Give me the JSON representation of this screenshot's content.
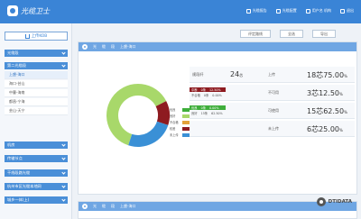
{
  "app": {
    "title": "光缆卫士"
  },
  "header": {
    "items": [
      {
        "label": "光缆报告",
        "icon": "report-icon"
      },
      {
        "label": "光缆配置",
        "icon": "settings-icon"
      },
      {
        "label": "用户名 机构",
        "icon": "user-icon"
      },
      {
        "label": "退出",
        "icon": "logout-icon"
      }
    ]
  },
  "sidebar": {
    "upload_label": "上传KOB",
    "groups": [
      {
        "label": "光缆段"
      },
      {
        "label": "第二光缆段"
      },
      {
        "label": "机房"
      },
      {
        "label": "传输节点"
      },
      {
        "label": "干线段路光缆"
      },
      {
        "label": "杭州市区光缆本地网"
      },
      {
        "label": "城乡一体(上)"
      }
    ],
    "items": [
      {
        "label": "上虞-海口"
      },
      {
        "label": "海口-芸山"
      },
      {
        "label": "中曹-海南"
      },
      {
        "label": "都昌-宁海"
      },
      {
        "label": "芸山-天宁"
      }
    ]
  },
  "toolbar": {
    "buttons": [
      {
        "label": "评定路线"
      },
      {
        "label": "全选"
      },
      {
        "label": "导出"
      }
    ]
  },
  "panel": {
    "tabs": [
      "光",
      "缆",
      "段"
    ],
    "crumb": "上虞-海口"
  },
  "legend": [
    {
      "label": "优良",
      "color": "#3fae3b"
    },
    {
      "label": "良好",
      "color": "#a8d86a"
    },
    {
      "label": "不合格",
      "color": "#e3a23a"
    },
    {
      "label": "较差",
      "color": "#8e1b20"
    },
    {
      "label": "未上传",
      "color": "#3a90d6"
    }
  ],
  "stats": [
    {
      "label": "规段纤",
      "count": "24",
      "unit": "芯",
      "rlabel": "上传",
      "value": "18芯",
      "pct": "75.00",
      "pct_unit": "%"
    },
    {
      "label": "",
      "count": "",
      "unit": "",
      "rlabel": "不可用",
      "value": "3芯",
      "pct": "12.50",
      "pct_unit": "%",
      "pills": [
        {
          "a": "中断",
          "b": "0条",
          "c": "12.50%",
          "color": "#8e1b20"
        },
        {
          "a": "不合格",
          "b": "0条",
          "c": "0.00%",
          "color": "#e3a23a"
        }
      ]
    },
    {
      "label": "",
      "count": "",
      "unit": "",
      "rlabel": "可使用",
      "value": "15芯",
      "pct": "62.50",
      "pct_unit": "%",
      "pills": [
        {
          "a": "优良",
          "b": "0条",
          "c": "0.00%",
          "color": "#3fae3b"
        },
        {
          "a": "良好",
          "b": "15条",
          "c": "62.50%",
          "color": "#a8d86a"
        }
      ]
    },
    {
      "label": "",
      "count": "",
      "unit": "",
      "rlabel": "未上传",
      "value": "6芯",
      "pct": "25.00",
      "pct_unit": "%"
    }
  ],
  "panel2": {
    "tabs": [
      "光",
      "缆",
      "段"
    ],
    "crumb": "上虞-海口"
  },
  "watermark": {
    "text": "DTIDATA"
  },
  "chart_data": {
    "type": "pie",
    "categories": [
      "良好",
      "较差",
      "未上传"
    ],
    "values": [
      62.5,
      12.5,
      25.0
    ],
    "colors": [
      "#a8d86a",
      "#8e1b20",
      "#3a90d6"
    ],
    "donut": true
  }
}
